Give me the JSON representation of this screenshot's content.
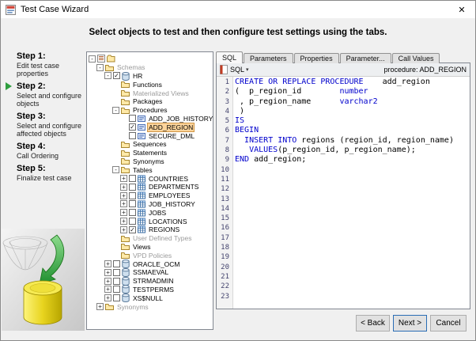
{
  "window": {
    "title": "Test Case Wizard",
    "close_glyph": "✕"
  },
  "header": {
    "instruction": "Select objects to test and then configure test settings using the tabs."
  },
  "steps": {
    "items": [
      {
        "title": "Step 1:",
        "desc": "Edit test case properties",
        "current": false
      },
      {
        "title": "Step 2:",
        "desc": "Select and configure objects",
        "current": true
      },
      {
        "title": "Step 3:",
        "desc": "Select and configure affected objects",
        "current": false
      },
      {
        "title": "Step 4:",
        "desc": "Call Ordering",
        "current": false
      },
      {
        "title": "Step 5:",
        "desc": "Finalize test case",
        "current": false
      }
    ]
  },
  "tree": {
    "rows": [
      {
        "depth": 0,
        "expand": "minus",
        "icon": "root",
        "label": ""
      },
      {
        "depth": 1,
        "expand": "minus",
        "icon": "folder",
        "label": "Schemas",
        "gray": true
      },
      {
        "depth": 2,
        "expand": "minus",
        "check": "checked",
        "icon": "db",
        "label": "HR"
      },
      {
        "depth": 3,
        "icon": "folder",
        "label": "Functions"
      },
      {
        "depth": 3,
        "icon": "folder",
        "label": "Materialized Views",
        "gray": true
      },
      {
        "depth": 3,
        "icon": "folder",
        "label": "Packages"
      },
      {
        "depth": 3,
        "expand": "minus",
        "icon": "folder",
        "label": "Procedures"
      },
      {
        "depth": 4,
        "check": "unchecked",
        "icon": "proc",
        "label": "ADD_JOB_HISTORY"
      },
      {
        "depth": 4,
        "check": "checked",
        "icon": "proc",
        "label": "ADD_REGION",
        "selected": true
      },
      {
        "depth": 4,
        "check": "unchecked",
        "icon": "proc",
        "label": "SECURE_DML"
      },
      {
        "depth": 3,
        "icon": "folder",
        "label": "Sequences"
      },
      {
        "depth": 3,
        "icon": "folder",
        "label": "Statements"
      },
      {
        "depth": 3,
        "icon": "folder",
        "label": "Synonyms"
      },
      {
        "depth": 3,
        "expand": "minus",
        "icon": "folder",
        "label": "Tables"
      },
      {
        "depth": 4,
        "expand": "plus",
        "check": "unchecked",
        "icon": "table",
        "label": "COUNTRIES"
      },
      {
        "depth": 4,
        "expand": "plus",
        "check": "unchecked",
        "icon": "table",
        "label": "DEPARTMENTS"
      },
      {
        "depth": 4,
        "expand": "plus",
        "check": "unchecked",
        "icon": "table",
        "label": "EMPLOYEES"
      },
      {
        "depth": 4,
        "expand": "plus",
        "check": "unchecked",
        "icon": "table",
        "label": "JOB_HISTORY"
      },
      {
        "depth": 4,
        "expand": "plus",
        "check": "unchecked",
        "icon": "table",
        "label": "JOBS"
      },
      {
        "depth": 4,
        "expand": "plus",
        "check": "unchecked",
        "icon": "table",
        "label": "LOCATIONS"
      },
      {
        "depth": 4,
        "expand": "plus",
        "check": "checked",
        "icon": "table",
        "label": "REGIONS"
      },
      {
        "depth": 3,
        "icon": "folder",
        "label": "User Defined Types",
        "gray": true
      },
      {
        "depth": 3,
        "icon": "folder",
        "label": "Views"
      },
      {
        "depth": 3,
        "icon": "folder",
        "label": "VPD Policies",
        "gray": true
      },
      {
        "depth": 2,
        "expand": "plus",
        "check": "unchecked",
        "icon": "db",
        "label": "ORACLE_OCM"
      },
      {
        "depth": 2,
        "expand": "plus",
        "check": "unchecked",
        "icon": "db",
        "label": "SSMAEVAL"
      },
      {
        "depth": 2,
        "expand": "plus",
        "check": "unchecked",
        "icon": "db",
        "label": "STRMADMIN"
      },
      {
        "depth": 2,
        "expand": "plus",
        "check": "unchecked",
        "icon": "db",
        "label": "TESTPERMS"
      },
      {
        "depth": 2,
        "expand": "plus",
        "check": "unchecked",
        "icon": "db",
        "label": "XS$NULL"
      },
      {
        "depth": 1,
        "expand": "plus",
        "icon": "folder",
        "label": "Synonyms",
        "gray": true
      }
    ]
  },
  "editor": {
    "tabs": [
      {
        "label": "SQL",
        "active": true
      },
      {
        "label": "Parameters",
        "active": false
      },
      {
        "label": "Properties",
        "active": false
      },
      {
        "label": "Parameter...",
        "active": false
      },
      {
        "label": "Call Values",
        "active": false
      }
    ],
    "toolbar": {
      "left_label": "SQL",
      "caret": "▾",
      "right_label": "procedure: ADD_REGION"
    },
    "line_count": 23,
    "lines": [
      [
        {
          "t": "CREATE OR REPLACE PROCEDURE",
          "k": true
        },
        {
          "t": "    add_region",
          "k": false
        }
      ],
      [
        {
          "t": "(  p_region_id        ",
          "k": false
        },
        {
          "t": "number",
          "k": true
        }
      ],
      [
        {
          "t": " , p_region_name      ",
          "k": false
        },
        {
          "t": "varchar2",
          "k": true
        }
      ],
      [
        {
          "t": " )",
          "k": false
        }
      ],
      [
        {
          "t": "IS",
          "k": true
        }
      ],
      [
        {
          "t": "BEGIN",
          "k": true
        }
      ],
      [
        {
          "t": "  ",
          "k": false
        },
        {
          "t": "INSERT INTO",
          "k": true
        },
        {
          "t": " regions (region_id, region_name)",
          "k": false
        }
      ],
      [
        {
          "t": "   ",
          "k": false
        },
        {
          "t": "VALUES",
          "k": true
        },
        {
          "t": "(p_region_id, p_region_name);",
          "k": false
        }
      ],
      [
        {
          "t": "END",
          "k": true
        },
        {
          "t": " add_region;",
          "k": false
        }
      ]
    ]
  },
  "footer": {
    "back": "< Back",
    "next": "Next >",
    "cancel": "Cancel"
  },
  "colors": {
    "keyword": "#0000cc",
    "selected_bg": "#fcd49b",
    "selected_border": "#cf9545",
    "step_arrow": "#2e9e3e"
  }
}
